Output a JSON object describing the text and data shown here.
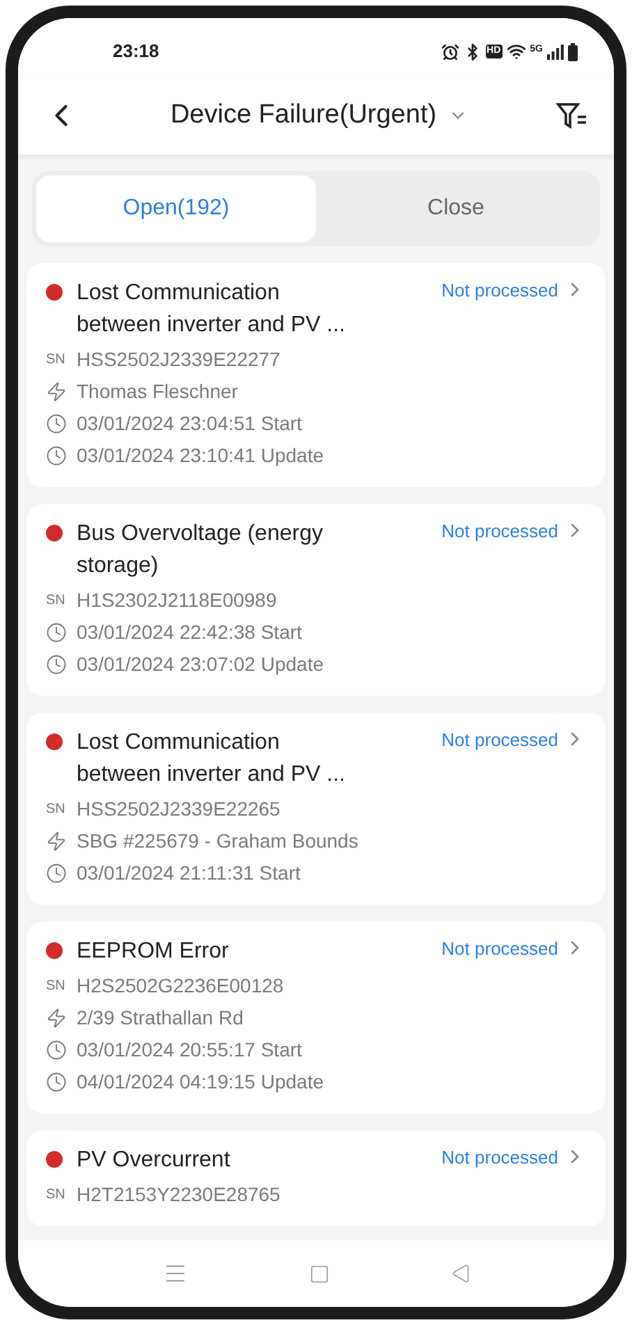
{
  "status_bar": {
    "time": "23:18",
    "hd": "HD",
    "network": "5G"
  },
  "header": {
    "title": "Device Failure(Urgent)"
  },
  "tabs": [
    {
      "label": "Open(192)",
      "selected": true
    },
    {
      "label": "Close",
      "selected": false
    }
  ],
  "alarms": [
    {
      "title": "Lost Communication between inverter and PV ...",
      "status": "Not processed",
      "rows": [
        {
          "kind": "sn",
          "label": "SN",
          "text": "HSS2502J2339E22277"
        },
        {
          "kind": "site",
          "text": "Thomas Fleschner"
        },
        {
          "kind": "time",
          "text": "03/01/2024 23:04:51 Start"
        },
        {
          "kind": "time",
          "text": "03/01/2024 23:10:41 Update"
        }
      ]
    },
    {
      "title": "Bus Overvoltage (energy storage)",
      "status": "Not processed",
      "rows": [
        {
          "kind": "sn",
          "label": "SN",
          "text": "H1S2302J2118E00989"
        },
        {
          "kind": "time",
          "text": "03/01/2024 22:42:38 Start"
        },
        {
          "kind": "time",
          "text": "03/01/2024 23:07:02 Update"
        }
      ]
    },
    {
      "title": "Lost Communication between inverter and PV ...",
      "status": "Not processed",
      "rows": [
        {
          "kind": "sn",
          "label": "SN",
          "text": "HSS2502J2339E22265"
        },
        {
          "kind": "site",
          "text": "SBG #225679 - Graham Bounds"
        },
        {
          "kind": "time",
          "text": "03/01/2024 21:11:31 Start"
        }
      ]
    },
    {
      "title": "EEPROM Error",
      "status": "Not processed",
      "rows": [
        {
          "kind": "sn",
          "label": "SN",
          "text": "H2S2502G2236E00128"
        },
        {
          "kind": "site",
          "text": "2/39 Strathallan Rd"
        },
        {
          "kind": "time",
          "text": "03/01/2024 20:55:17 Start"
        },
        {
          "kind": "time",
          "text": "04/01/2024 04:19:15 Update"
        }
      ]
    },
    {
      "title": "PV Overcurrent",
      "status": "Not processed",
      "rows": [
        {
          "kind": "sn",
          "label": "SN",
          "text": "H2T2153Y2230E28765"
        }
      ]
    }
  ]
}
